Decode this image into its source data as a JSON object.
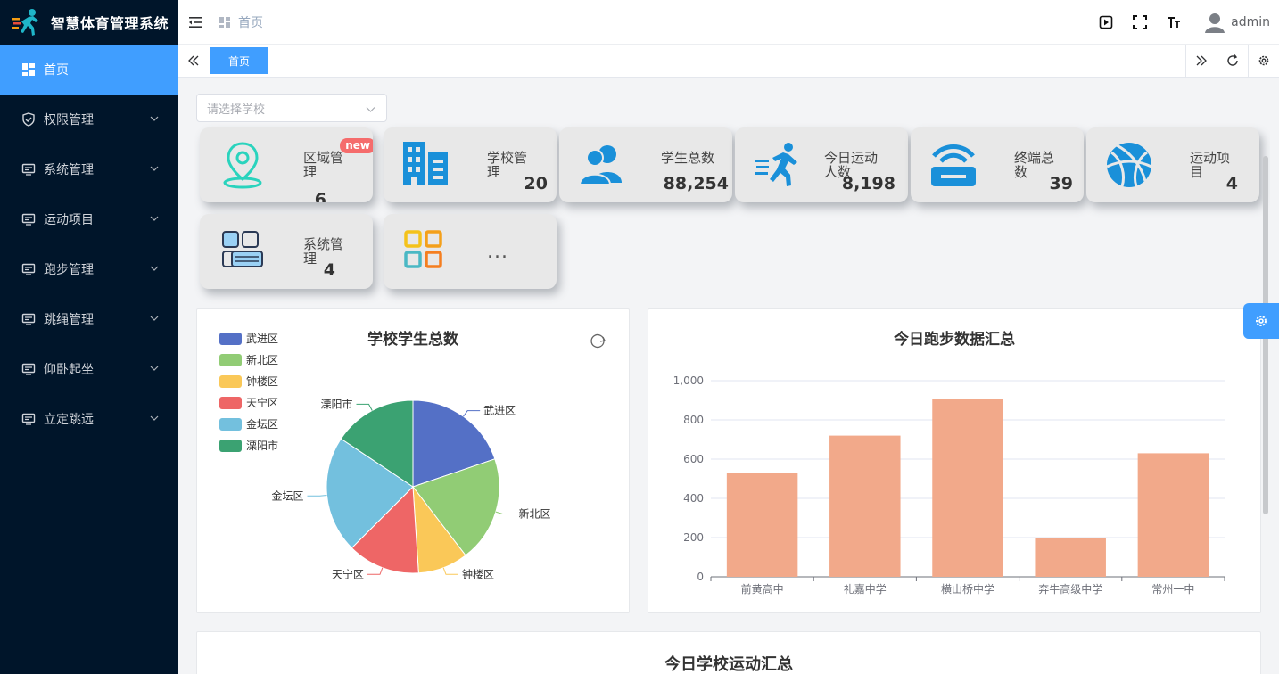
{
  "brand": {
    "title": "智慧体育管理系统"
  },
  "sidebar": {
    "items": [
      {
        "label": "首页",
        "icon": "dashboard-icon",
        "active": true
      },
      {
        "label": "权限管理",
        "icon": "shield-icon"
      },
      {
        "label": "系统管理",
        "icon": "monitor-icon"
      },
      {
        "label": "运动项目",
        "icon": "monitor-icon"
      },
      {
        "label": "跑步管理",
        "icon": "monitor-icon"
      },
      {
        "label": "跳绳管理",
        "icon": "monitor-icon"
      },
      {
        "label": "仰卧起坐",
        "icon": "monitor-icon"
      },
      {
        "label": "立定跳远",
        "icon": "monitor-icon"
      }
    ]
  },
  "header": {
    "breadcrumb": "首页",
    "username": "admin"
  },
  "tabs": {
    "active_label": "首页"
  },
  "filter": {
    "placeholder": "请选择学校"
  },
  "cards": [
    {
      "label": "区域管理",
      "value": "6",
      "badge": "new",
      "icon": "location-pin-icon"
    },
    {
      "label": "学校管理",
      "value": "20",
      "icon": "building-icon"
    },
    {
      "label": "学生总数",
      "value": "88,254",
      "icon": "users-icon"
    },
    {
      "label": "今日运动人数",
      "value": "8,198",
      "icon": "runner-icon"
    },
    {
      "label": "终端总数",
      "value": "39",
      "icon": "wifi-terminal-icon"
    },
    {
      "label": "运动项目",
      "value": "4",
      "icon": "basketball-icon"
    },
    {
      "label": "系统管理",
      "value": "4",
      "icon": "system-grid-icon"
    },
    {
      "label": "",
      "value": "...",
      "icon": "apps-icon"
    }
  ],
  "colors": {
    "accent": "#409eff",
    "sidebar_bg": "#00152a",
    "bar": "#f2a98a",
    "pie": [
      "#5470c6",
      "#91cc75",
      "#fac858",
      "#ee6666",
      "#73c0de",
      "#3ba272"
    ]
  },
  "chart_data": [
    {
      "type": "pie",
      "title": "学校学生总数",
      "legend_position": "top-left",
      "categories": [
        "武进区",
        "新北区",
        "钟楼区",
        "天宁区",
        "金坛区",
        "溧阳市"
      ],
      "values": [
        19,
        19,
        9,
        13,
        21,
        15
      ]
    },
    {
      "type": "bar",
      "title": "今日跑步数据汇总",
      "categories": [
        "前黄高中",
        "礼嘉中学",
        "横山桥中学",
        "奔牛高级中学",
        "常州一中"
      ],
      "values": [
        530,
        720,
        905,
        200,
        630
      ],
      "ylim": [
        0,
        1000
      ],
      "yticks": [
        "0",
        "200",
        "400",
        "600",
        "800",
        "1,000"
      ],
      "grid": true
    }
  ],
  "bottom_panel": {
    "title": "今日学校运动汇总"
  }
}
